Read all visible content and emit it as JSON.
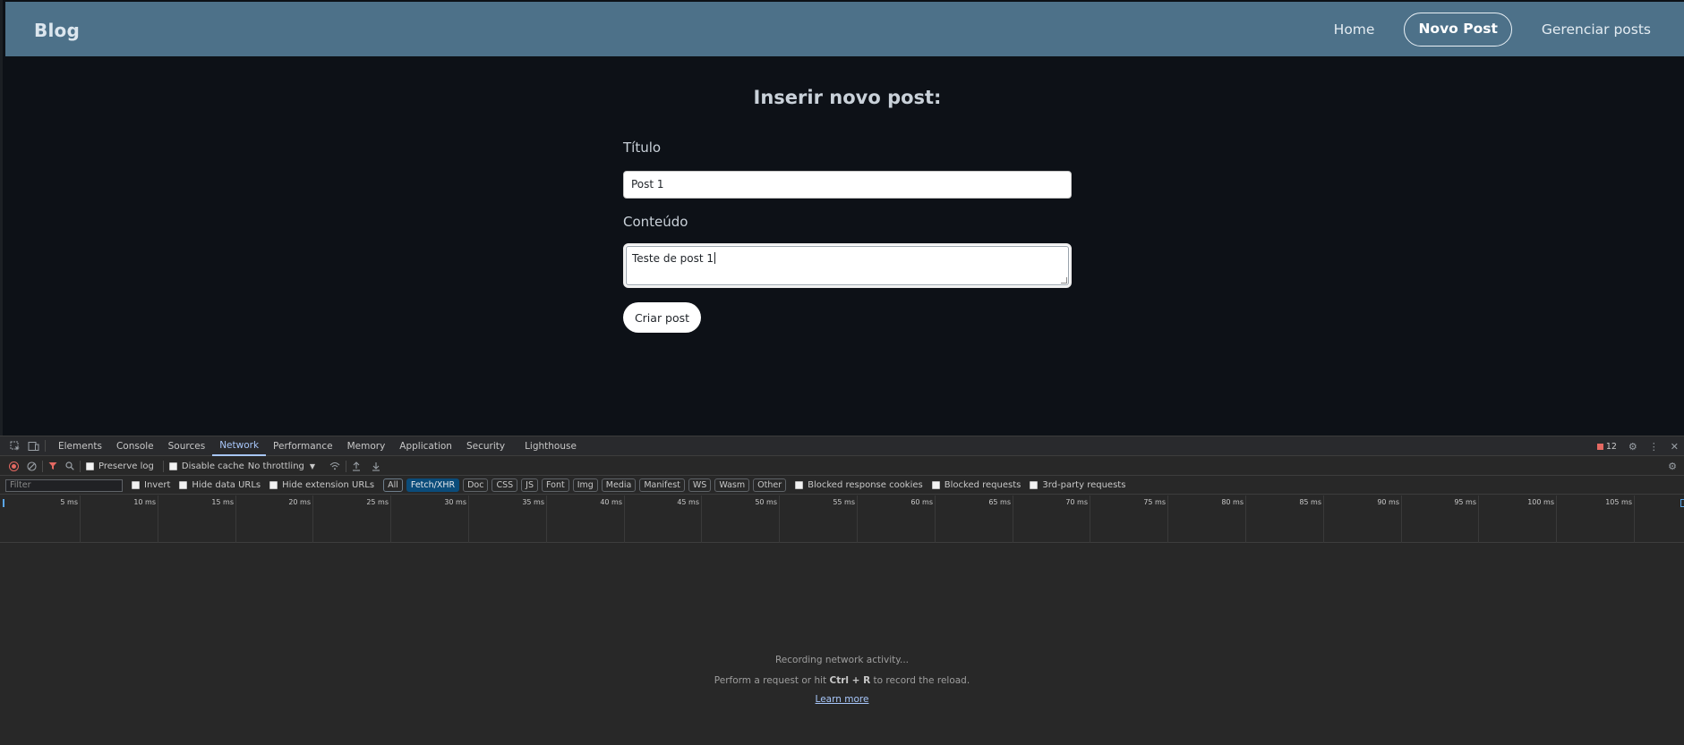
{
  "navbar": {
    "brand": "Blog",
    "links": [
      {
        "label": "Home"
      },
      {
        "label": "Novo Post"
      },
      {
        "label": "Gerenciar posts"
      }
    ]
  },
  "form": {
    "heading": "Inserir novo post:",
    "titulo_label": "Título",
    "titulo_value": "Post 1",
    "conteudo_label": "Conteúdo",
    "conteudo_value": "Teste de post 1",
    "submit_label": "Criar post"
  },
  "devtools": {
    "tabs": [
      "Elements",
      "Console",
      "Sources",
      "Network",
      "Performance",
      "Memory",
      "Application",
      "Security",
      "Lighthouse"
    ],
    "active_tab": "Network",
    "issues_count": "12",
    "toolbar": {
      "preserve_log": "Preserve log",
      "disable_cache": "Disable cache",
      "throttling": "No throttling"
    },
    "filterbar": {
      "filter_placeholder": "Filter",
      "invert": "Invert",
      "hide_data_urls": "Hide data URLs",
      "hide_extension_urls": "Hide extension URLs",
      "types": [
        "All",
        "Fetch/XHR",
        "Doc",
        "CSS",
        "JS",
        "Font",
        "Img",
        "Media",
        "Manifest",
        "WS",
        "Wasm",
        "Other"
      ],
      "selected_type": "Fetch/XHR",
      "blocked_response_cookies": "Blocked response cookies",
      "blocked_requests": "Blocked requests",
      "third_party_requests": "3rd-party requests"
    },
    "timeline_ticks": [
      "5 ms",
      "10 ms",
      "15 ms",
      "20 ms",
      "25 ms",
      "30 ms",
      "35 ms",
      "40 ms",
      "45 ms",
      "50 ms",
      "55 ms",
      "60 ms",
      "65 ms",
      "70 ms",
      "75 ms",
      "80 ms",
      "85 ms",
      "90 ms",
      "95 ms",
      "100 ms",
      "105 ms"
    ],
    "empty_state": {
      "line1": "Recording network activity...",
      "line2_prefix": "Perform a request or hit ",
      "line2_keys": "Ctrl + R",
      "line2_suffix": " to record the reload.",
      "learn_more": "Learn more"
    }
  }
}
